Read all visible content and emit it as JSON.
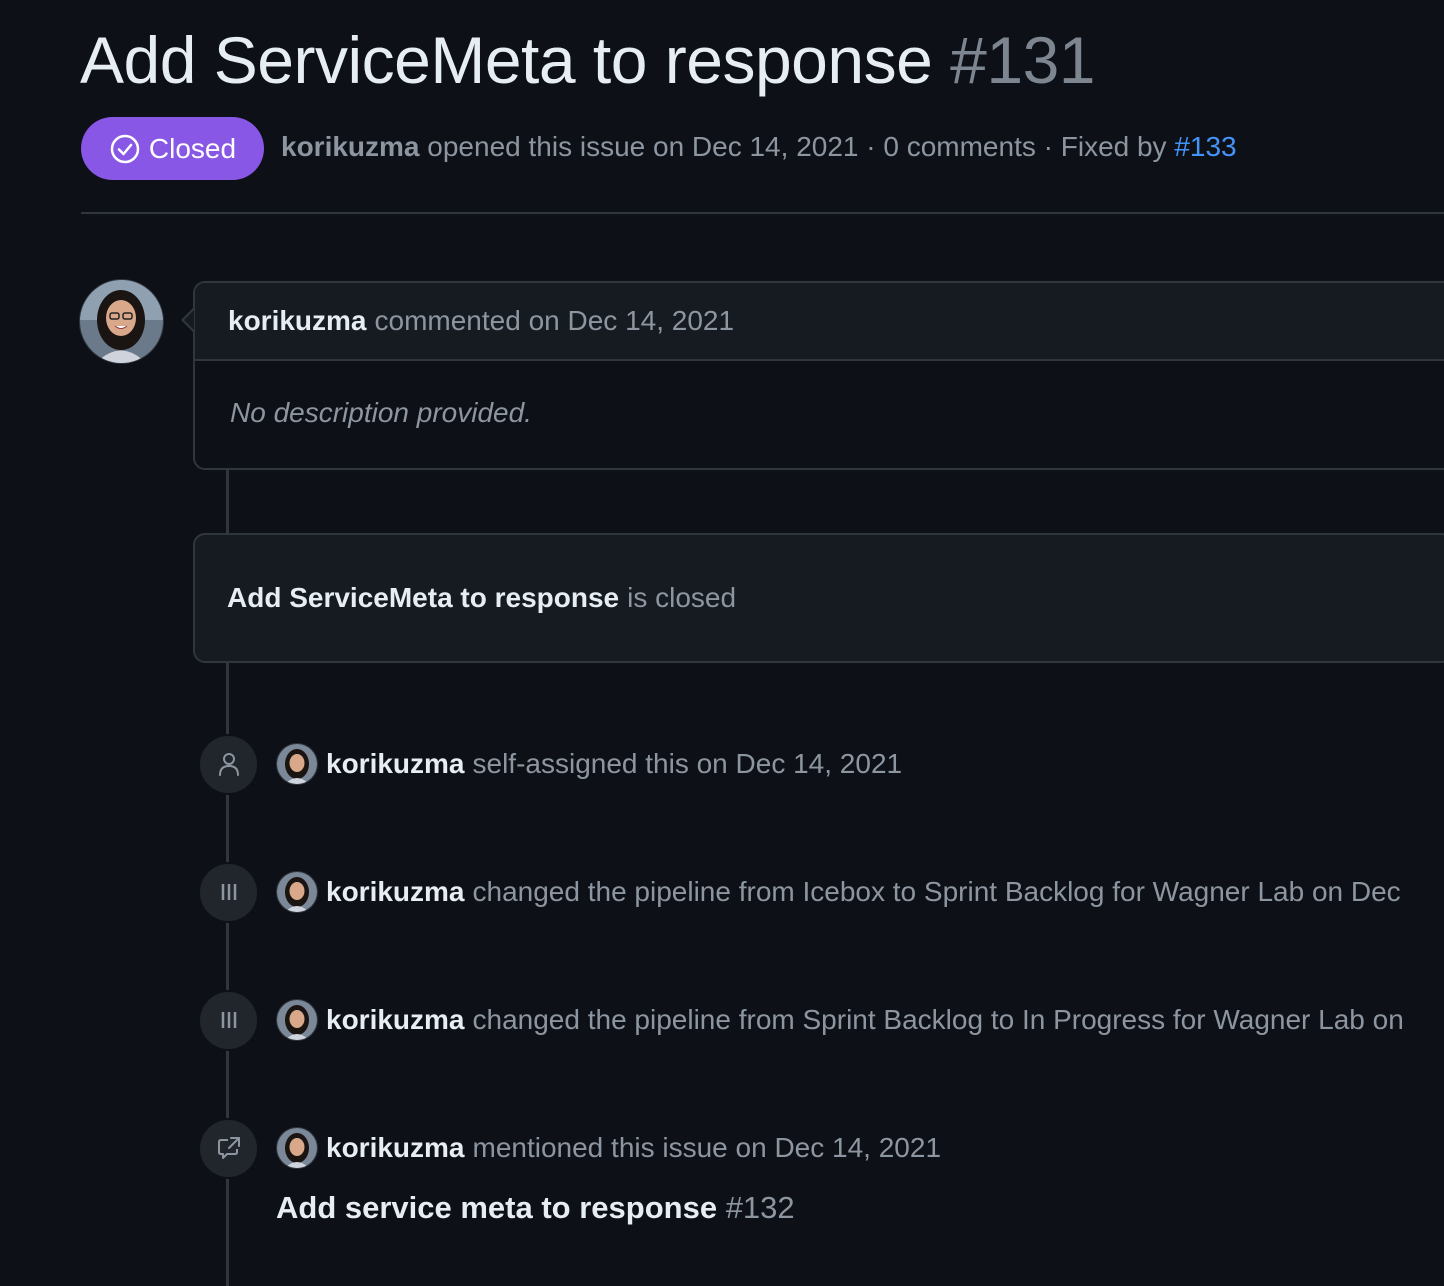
{
  "issue": {
    "title": "Add ServiceMeta to response",
    "number": "#131",
    "state": "Closed",
    "author": "korikuzma",
    "opened_text": "opened this issue on Dec 14, 2021 · 0 comments · Fixed by",
    "fixed_by": "#133"
  },
  "comment": {
    "author": "korikuzma",
    "action": "commented on Dec 14, 2021",
    "body": "No description provided."
  },
  "closed_notice": {
    "title": "Add ServiceMeta to response",
    "suffix": "is closed"
  },
  "events": [
    {
      "icon": "person-icon",
      "author": "korikuzma",
      "text": "self-assigned this on Dec 14, 2021"
    },
    {
      "icon": "pipeline-icon",
      "author": "korikuzma",
      "text": "changed the pipeline from Icebox to Sprint Backlog for Wagner Lab on Dec"
    },
    {
      "icon": "pipeline-icon",
      "author": "korikuzma",
      "text": "changed the pipeline from Sprint Backlog to In Progress for Wagner Lab on"
    },
    {
      "icon": "cross-reference-icon",
      "author": "korikuzma",
      "text": "mentioned this issue on Dec 14, 2021"
    }
  ],
  "reference": {
    "title": "Add service meta to response",
    "number": "#132"
  },
  "colors": {
    "background": "#0d1117",
    "closed_badge": "#8957e5",
    "link": "#4493f8",
    "border": "#30363d"
  }
}
